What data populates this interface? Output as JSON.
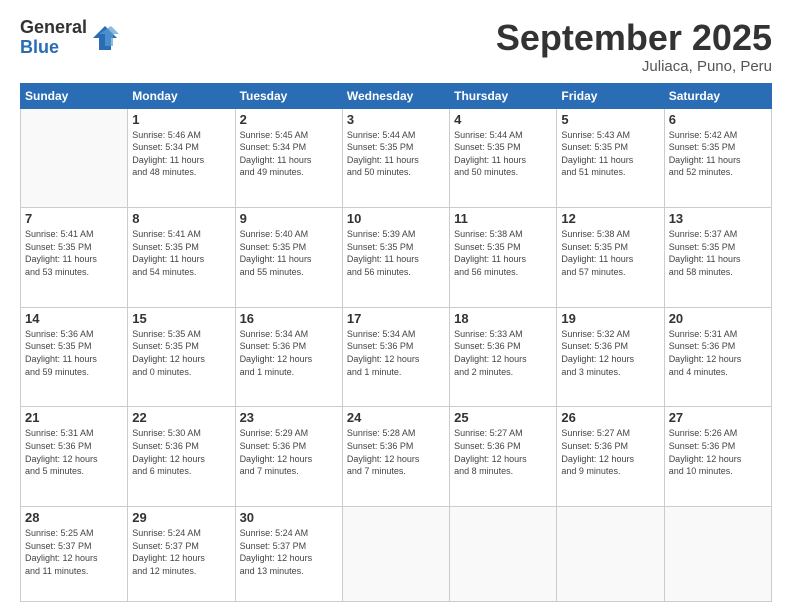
{
  "logo": {
    "general": "General",
    "blue": "Blue"
  },
  "header": {
    "month": "September 2025",
    "location": "Juliaca, Puno, Peru"
  },
  "weekdays": [
    "Sunday",
    "Monday",
    "Tuesday",
    "Wednesday",
    "Thursday",
    "Friday",
    "Saturday"
  ],
  "weeks": [
    [
      {
        "day": "",
        "info": ""
      },
      {
        "day": "1",
        "info": "Sunrise: 5:46 AM\nSunset: 5:34 PM\nDaylight: 11 hours\nand 48 minutes."
      },
      {
        "day": "2",
        "info": "Sunrise: 5:45 AM\nSunset: 5:34 PM\nDaylight: 11 hours\nand 49 minutes."
      },
      {
        "day": "3",
        "info": "Sunrise: 5:44 AM\nSunset: 5:35 PM\nDaylight: 11 hours\nand 50 minutes."
      },
      {
        "day": "4",
        "info": "Sunrise: 5:44 AM\nSunset: 5:35 PM\nDaylight: 11 hours\nand 50 minutes."
      },
      {
        "day": "5",
        "info": "Sunrise: 5:43 AM\nSunset: 5:35 PM\nDaylight: 11 hours\nand 51 minutes."
      },
      {
        "day": "6",
        "info": "Sunrise: 5:42 AM\nSunset: 5:35 PM\nDaylight: 11 hours\nand 52 minutes."
      }
    ],
    [
      {
        "day": "7",
        "info": "Sunrise: 5:41 AM\nSunset: 5:35 PM\nDaylight: 11 hours\nand 53 minutes."
      },
      {
        "day": "8",
        "info": "Sunrise: 5:41 AM\nSunset: 5:35 PM\nDaylight: 11 hours\nand 54 minutes."
      },
      {
        "day": "9",
        "info": "Sunrise: 5:40 AM\nSunset: 5:35 PM\nDaylight: 11 hours\nand 55 minutes."
      },
      {
        "day": "10",
        "info": "Sunrise: 5:39 AM\nSunset: 5:35 PM\nDaylight: 11 hours\nand 56 minutes."
      },
      {
        "day": "11",
        "info": "Sunrise: 5:38 AM\nSunset: 5:35 PM\nDaylight: 11 hours\nand 56 minutes."
      },
      {
        "day": "12",
        "info": "Sunrise: 5:38 AM\nSunset: 5:35 PM\nDaylight: 11 hours\nand 57 minutes."
      },
      {
        "day": "13",
        "info": "Sunrise: 5:37 AM\nSunset: 5:35 PM\nDaylight: 11 hours\nand 58 minutes."
      }
    ],
    [
      {
        "day": "14",
        "info": "Sunrise: 5:36 AM\nSunset: 5:35 PM\nDaylight: 11 hours\nand 59 minutes."
      },
      {
        "day": "15",
        "info": "Sunrise: 5:35 AM\nSunset: 5:35 PM\nDaylight: 12 hours\nand 0 minutes."
      },
      {
        "day": "16",
        "info": "Sunrise: 5:34 AM\nSunset: 5:36 PM\nDaylight: 12 hours\nand 1 minute."
      },
      {
        "day": "17",
        "info": "Sunrise: 5:34 AM\nSunset: 5:36 PM\nDaylight: 12 hours\nand 1 minute."
      },
      {
        "day": "18",
        "info": "Sunrise: 5:33 AM\nSunset: 5:36 PM\nDaylight: 12 hours\nand 2 minutes."
      },
      {
        "day": "19",
        "info": "Sunrise: 5:32 AM\nSunset: 5:36 PM\nDaylight: 12 hours\nand 3 minutes."
      },
      {
        "day": "20",
        "info": "Sunrise: 5:31 AM\nSunset: 5:36 PM\nDaylight: 12 hours\nand 4 minutes."
      }
    ],
    [
      {
        "day": "21",
        "info": "Sunrise: 5:31 AM\nSunset: 5:36 PM\nDaylight: 12 hours\nand 5 minutes."
      },
      {
        "day": "22",
        "info": "Sunrise: 5:30 AM\nSunset: 5:36 PM\nDaylight: 12 hours\nand 6 minutes."
      },
      {
        "day": "23",
        "info": "Sunrise: 5:29 AM\nSunset: 5:36 PM\nDaylight: 12 hours\nand 7 minutes."
      },
      {
        "day": "24",
        "info": "Sunrise: 5:28 AM\nSunset: 5:36 PM\nDaylight: 12 hours\nand 7 minutes."
      },
      {
        "day": "25",
        "info": "Sunrise: 5:27 AM\nSunset: 5:36 PM\nDaylight: 12 hours\nand 8 minutes."
      },
      {
        "day": "26",
        "info": "Sunrise: 5:27 AM\nSunset: 5:36 PM\nDaylight: 12 hours\nand 9 minutes."
      },
      {
        "day": "27",
        "info": "Sunrise: 5:26 AM\nSunset: 5:36 PM\nDaylight: 12 hours\nand 10 minutes."
      }
    ],
    [
      {
        "day": "28",
        "info": "Sunrise: 5:25 AM\nSunset: 5:37 PM\nDaylight: 12 hours\nand 11 minutes."
      },
      {
        "day": "29",
        "info": "Sunrise: 5:24 AM\nSunset: 5:37 PM\nDaylight: 12 hours\nand 12 minutes."
      },
      {
        "day": "30",
        "info": "Sunrise: 5:24 AM\nSunset: 5:37 PM\nDaylight: 12 hours\nand 13 minutes."
      },
      {
        "day": "",
        "info": ""
      },
      {
        "day": "",
        "info": ""
      },
      {
        "day": "",
        "info": ""
      },
      {
        "day": "",
        "info": ""
      }
    ]
  ]
}
